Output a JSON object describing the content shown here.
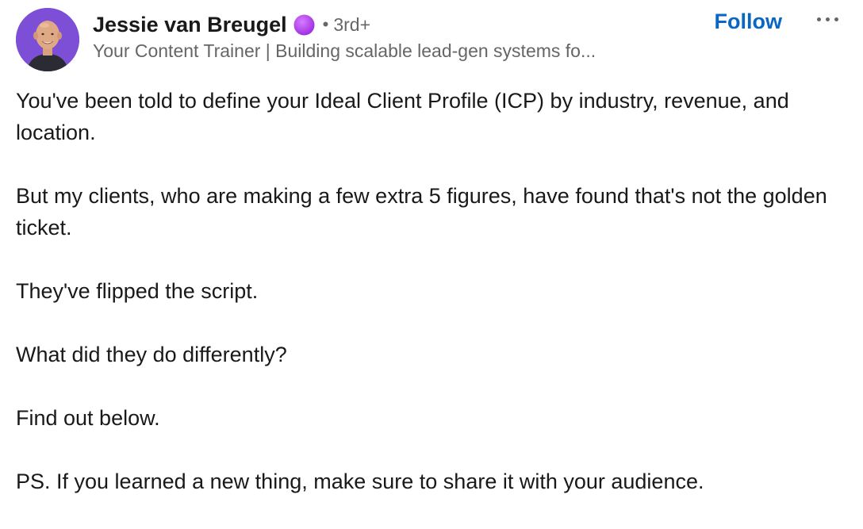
{
  "author": {
    "name": "Jessie van Breugel",
    "separator": "•",
    "degree": "3rd+",
    "headline": "Your Content Trainer | Building scalable lead-gen systems fo...",
    "avatar_bg": "#7d4fd6",
    "badge_color": "#b44ef0",
    "badge_icon": "purple-circle-icon"
  },
  "actions": {
    "follow_label": "Follow",
    "follow_color": "#0a66c2",
    "more_icon": "ellipsis-icon"
  },
  "post": {
    "paragraphs": [
      "You've been told to define your Ideal Client Profile (ICP) by industry, revenue, and location.",
      "But my clients, who are making a few extra 5 figures, have found that's not the golden ticket.",
      "They've flipped the script.",
      "What did they do differently?",
      "Find out below.",
      "PS. If you learned a new thing, make sure to share it with your audience."
    ]
  }
}
